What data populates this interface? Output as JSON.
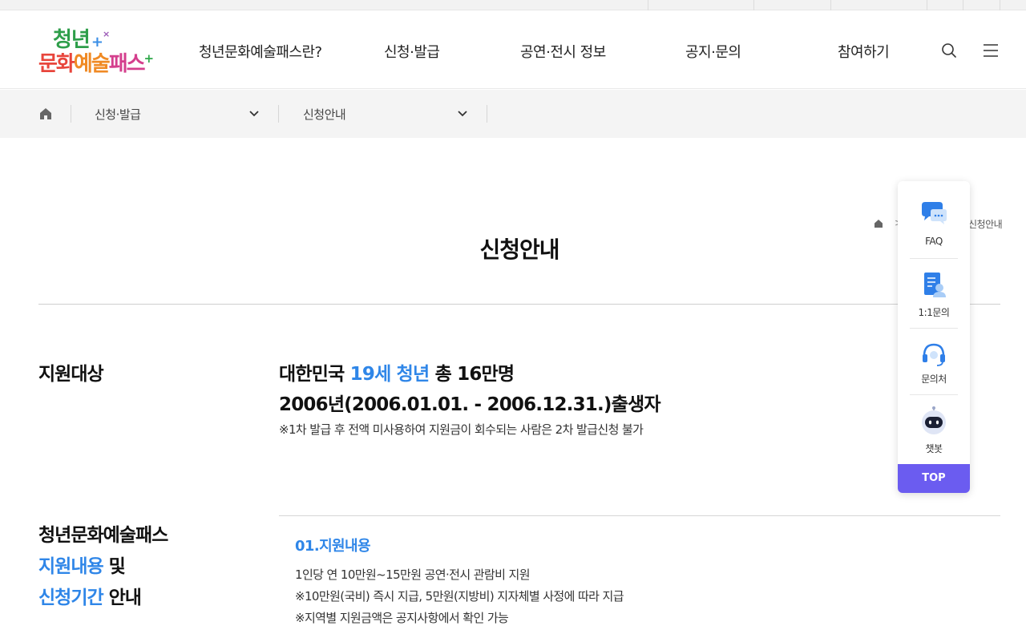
{
  "logo": {
    "line1": "청년",
    "line2_a": "문화",
    "line2_b": "예술",
    "line2_c": "패스",
    "plus": "+",
    "x_mark": "×"
  },
  "gnb": {
    "items": [
      {
        "label": "청년문화예술패스란?"
      },
      {
        "label": "신청·발급"
      },
      {
        "label": "공연·전시 정보"
      },
      {
        "label": "공지·문의"
      },
      {
        "label": "참여하기"
      }
    ],
    "search_icon": "search-icon",
    "menu_icon": "hamburger-menu-icon"
  },
  "subnav": {
    "home_icon": "home-icon",
    "dropdown1": "신청·발급",
    "dropdown2": "신청안내"
  },
  "breadcrumb": {
    "separator": ">",
    "current": "신청안내"
  },
  "page": {
    "title": "신청안내"
  },
  "section1": {
    "heading": "지원대상",
    "line1_pre": "대한민국 ",
    "line1_highlight": "19세 청년",
    "line1_post": " 총 16만명",
    "line2": "2006년(2006.01.01. - 2006.12.31.)출생자",
    "note": "※1차 발급 후 전액 미사용하여 지원금이 회수되는 사람은 2차 발급신청 불가"
  },
  "section2": {
    "heading_line1": "청년문화예술패스",
    "heading_line2_highlight": "지원내용",
    "heading_line2_post": " 및",
    "heading_line3_highlight": "신청기간",
    "heading_line3_post": " 안내",
    "sub_heading": "01.지원내용",
    "lines": [
      "1인당 연 10만원~15만원 공연·전시 관람비 지원",
      "※10만원(국비) 즉시 지급, 5만원(지방비) 지자체별 사정에 따라 지급",
      "※지역별 지원금액은 공지사항에서 확인 가능"
    ]
  },
  "quick_menu": {
    "items": [
      {
        "label": "FAQ",
        "icon": "faq-chat-icon"
      },
      {
        "label": "1:1문의",
        "icon": "document-inquiry-icon"
      },
      {
        "label": "문의처",
        "icon": "headset-icon"
      },
      {
        "label": "챗봇",
        "icon": "chatbot-robot-icon"
      }
    ],
    "top_label": "TOP"
  },
  "colors": {
    "accent_blue": "#2f86e8",
    "top_button": "#6b5cf0",
    "subnav_bg": "#f4f4f4"
  }
}
